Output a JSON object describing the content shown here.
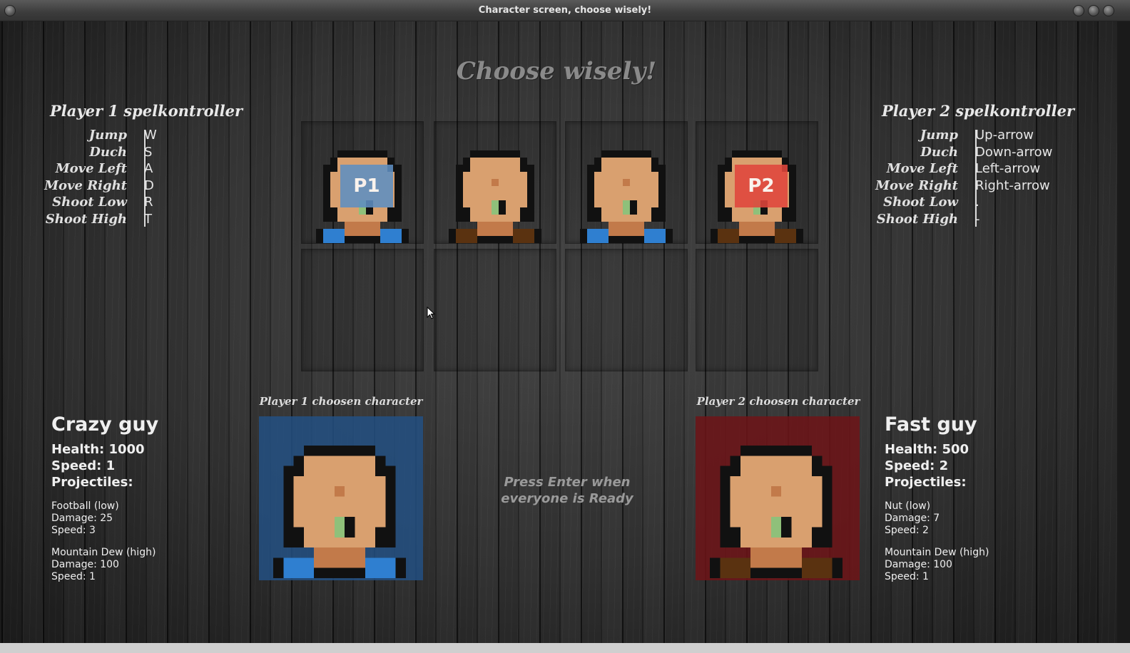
{
  "window": {
    "title": "Character screen, choose wisely!"
  },
  "headline": "Choose wisely!",
  "player1_controls": {
    "title": "Player 1 spelkontroller",
    "rows": [
      {
        "action": "Jump",
        "key": "W"
      },
      {
        "action": "Duch",
        "key": "S"
      },
      {
        "action": "Move Left",
        "key": "A"
      },
      {
        "action": "Move Right",
        "key": "D"
      },
      {
        "action": "Shoot Low",
        "key": "R"
      },
      {
        "action": "Shoot High",
        "key": "T"
      }
    ]
  },
  "player2_controls": {
    "title": "Player 2 spelkontroller",
    "rows": [
      {
        "action": "Jump",
        "key": "Up-arrow"
      },
      {
        "action": "Duch",
        "key": "Down-arrow"
      },
      {
        "action": "Move Left",
        "key": "Left-arrow"
      },
      {
        "action": "Move Right",
        "key": "Right-arrow"
      },
      {
        "action": "Shoot Low",
        "key": "."
      },
      {
        "action": "Shoot High",
        "key": "-"
      }
    ]
  },
  "grid": {
    "badges": {
      "p1": "P1",
      "p2": "P2"
    },
    "characters": [
      {
        "shirt": "#2f7fd0",
        "selected_by": "P1"
      },
      {
        "shirt": "#5a3210",
        "selected_by": ""
      },
      {
        "shirt": "#2f7fd0",
        "selected_by": ""
      },
      {
        "shirt": "#5a3210",
        "selected_by": "P2"
      }
    ]
  },
  "player1_choice": {
    "label": "Player 1 choosen character",
    "name": "Crazy guy",
    "health": "Health: 1000",
    "speed": "Speed: 1",
    "projectiles_label": "Projectiles:",
    "proj1": {
      "name": "Football (low)",
      "damage": "Damage: 25",
      "speed": "Speed: 3"
    },
    "proj2": {
      "name": "Mountain Dew (high)",
      "damage": "Damage: 100",
      "speed": "Speed: 1"
    }
  },
  "player2_choice": {
    "label": "Player 2 choosen character",
    "name": "Fast guy",
    "health": "Health: 500",
    "speed": "Speed: 2",
    "projectiles_label": "Projectiles:",
    "proj1": {
      "name": "Nut (low)",
      "damage": "Damage: 7",
      "speed": "Speed: 2"
    },
    "proj2": {
      "name": "Mountain Dew (high)",
      "damage": "Damage: 100",
      "speed": "Speed: 1"
    }
  },
  "press_enter": "Press Enter when everyone is Ready",
  "colors": {
    "p1": "#5f8fc2",
    "p2": "#e0463c",
    "skin": "#d9a06f",
    "blue_shirt": "#2f7fd0",
    "brown_shirt": "#5a3210"
  }
}
